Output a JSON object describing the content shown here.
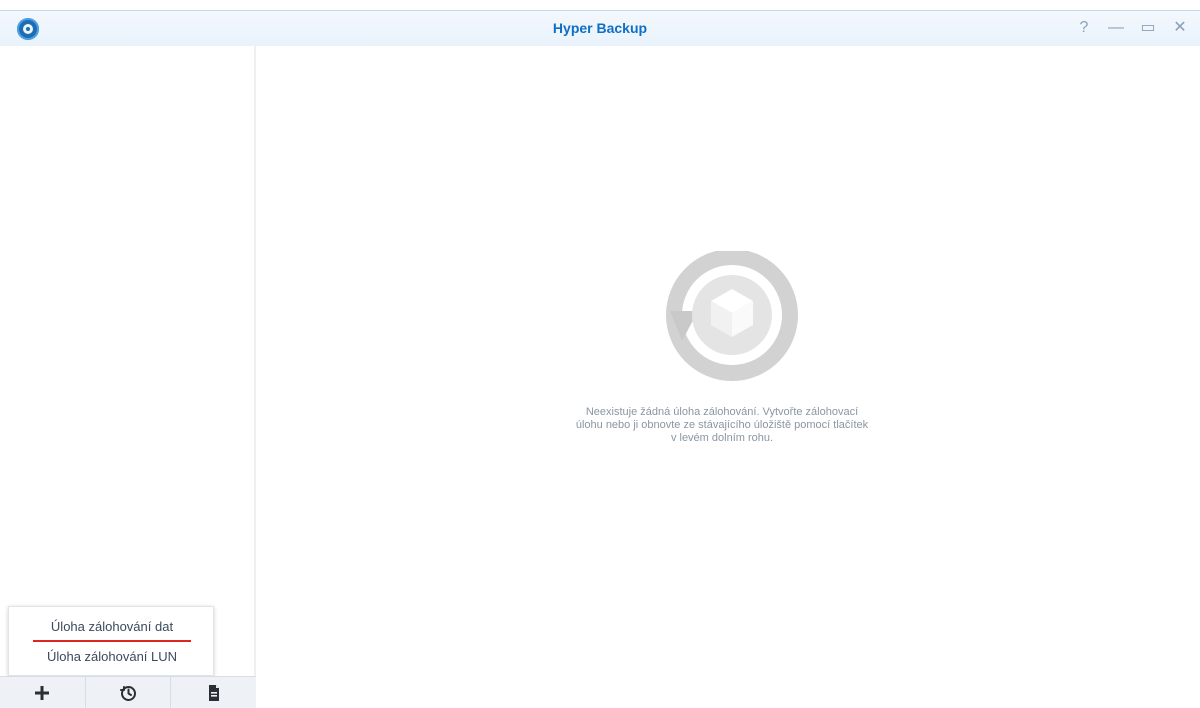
{
  "window": {
    "title": "Hyper Backup",
    "controls": {
      "help": "?",
      "minimize": "—",
      "maximize": "▭",
      "close": "✕"
    }
  },
  "main": {
    "empty_message": "Neexistuje žádná úloha zálohování. Vytvořte zálohovací úlohu nebo ji obnovte ze stávajícího úložiště pomocí tlačítek v levém dolním rohu."
  },
  "create_menu": {
    "items": [
      {
        "label": "Úloha zálohování dat"
      },
      {
        "label": "Úloha zálohování LUN"
      }
    ]
  },
  "toolbar": {
    "buttons": [
      {
        "icon": "plus-icon"
      },
      {
        "icon": "history-icon"
      },
      {
        "icon": "document-icon"
      }
    ]
  },
  "colors": {
    "accent": "#0f6fc6",
    "highlight_underline": "#e0241f",
    "muted_text": "#8a96a3"
  }
}
